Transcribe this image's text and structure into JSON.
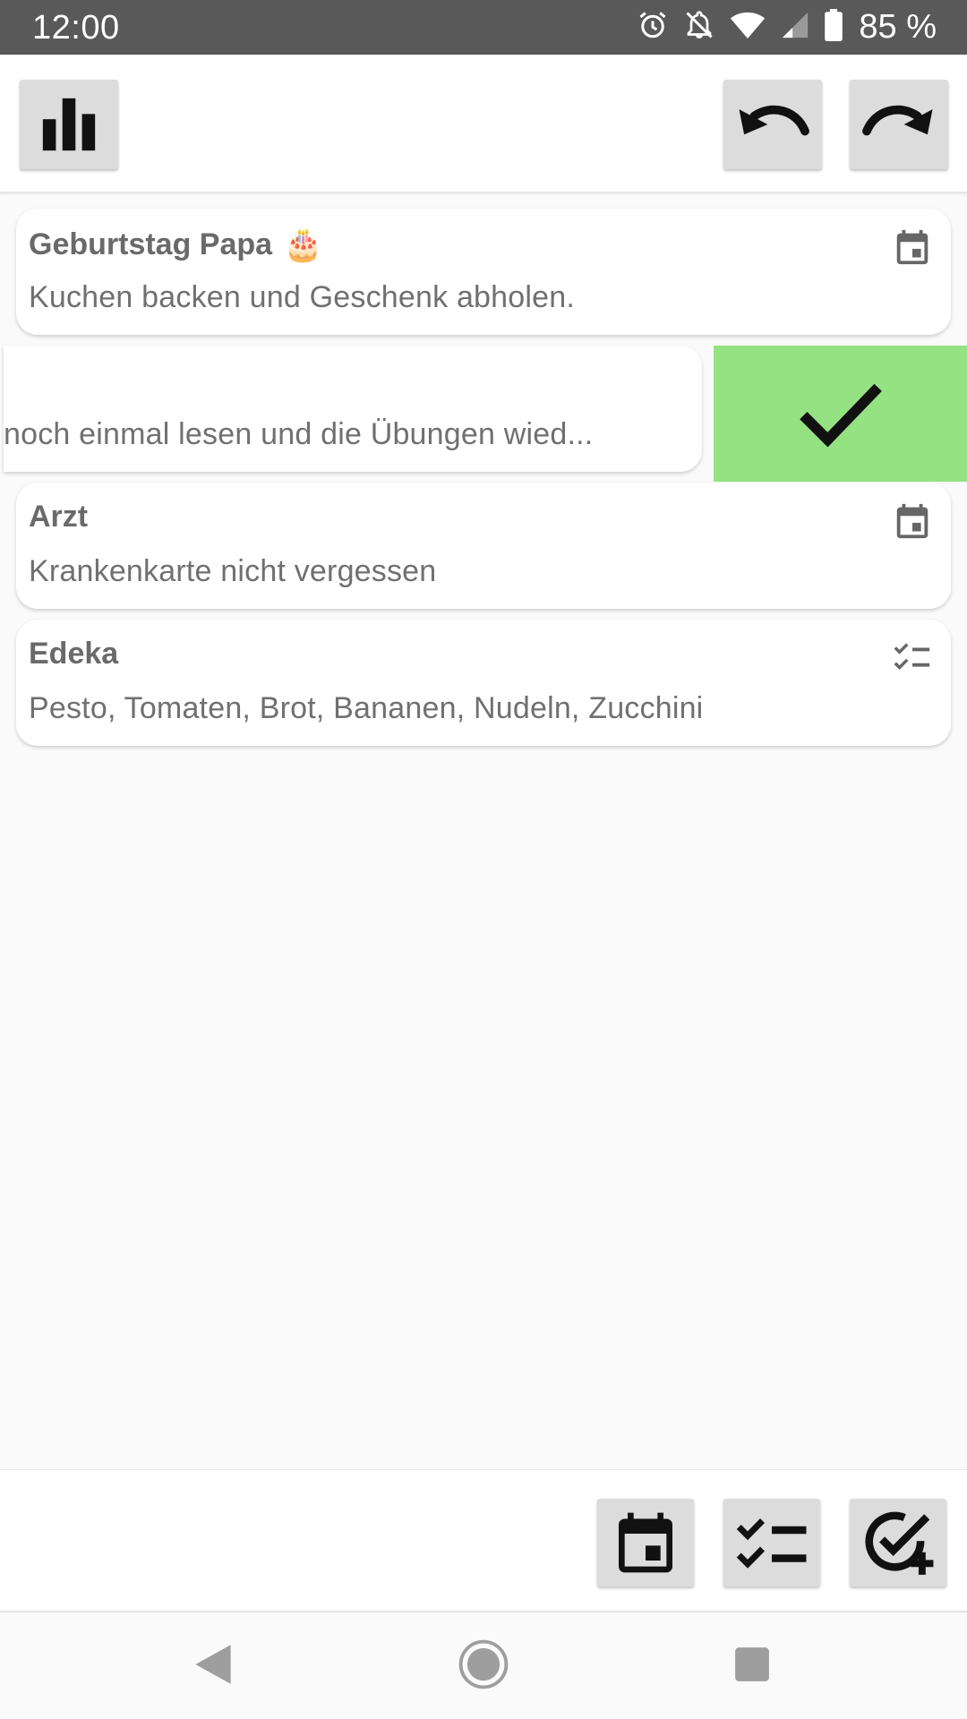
{
  "status_bar": {
    "time": "12:00",
    "battery": "85 %",
    "icons": [
      "alarm-icon",
      "notifications-off-icon",
      "wifi-icon",
      "signal-icon",
      "battery-icon"
    ]
  },
  "toolbar": {
    "left_buttons": [
      {
        "icon": "bar-chart-icon"
      }
    ],
    "right_buttons": [
      {
        "icon": "undo-icon"
      },
      {
        "icon": "redo-icon"
      }
    ]
  },
  "tasks": [
    {
      "title": "Geburtstag Papa",
      "emoji": "🎂",
      "description": "Kuchen backen und Geschenk abholen.",
      "type_icon": "calendar-icon"
    },
    {
      "title": "",
      "description": "noch einmal lesen und die Übungen wied...",
      "swiped": true,
      "action_icon": "checkmark-icon",
      "action_color": "#95e283"
    },
    {
      "title": "Arzt",
      "description": "Krankenkarte nicht vergessen",
      "type_icon": "calendar-icon"
    },
    {
      "title": "Edeka",
      "description": "Pesto, Tomaten, Brot, Bananen, Nudeln, Zucchini",
      "type_icon": "checklist-icon"
    }
  ],
  "bottom_toolbar": {
    "buttons": [
      {
        "icon": "calendar-event-icon"
      },
      {
        "icon": "checklist-icon"
      },
      {
        "icon": "add-task-icon"
      }
    ]
  },
  "navigation": {
    "buttons": [
      {
        "icon": "back-icon"
      },
      {
        "icon": "home-icon"
      },
      {
        "icon": "recents-icon"
      }
    ]
  }
}
